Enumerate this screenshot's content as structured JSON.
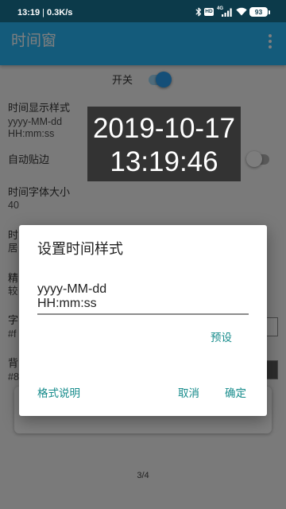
{
  "status_bar": {
    "time": "13:19",
    "separator": "|",
    "net_speed": "0.3K/s",
    "hd_label": "HD",
    "network_type": "4G",
    "battery_level": "93",
    "icons": [
      "bluetooth-icon",
      "hd-icon",
      "signal-icon",
      "wifi-icon",
      "battery-icon"
    ]
  },
  "app_bar": {
    "title": "时间窗",
    "menu_icon": "more-vert-icon"
  },
  "master_switch": {
    "label": "开关",
    "checked": true
  },
  "settings": {
    "time_format": {
      "label": "时间显示样式",
      "value_line1": "yyyy-MM-dd",
      "value_line2": "HH:mm:ss"
    },
    "auto_snap": {
      "label": "自动贴边",
      "checked": false
    },
    "font_size": {
      "label": "时间字体大小",
      "value": "40"
    },
    "partial_rows": [
      {
        "label": "时",
        "value": "居"
      },
      {
        "label": "精",
        "value": "较"
      },
      {
        "label": "字",
        "value": "#f",
        "swatch_color": "#ffffff"
      },
      {
        "label": "背",
        "value": "#8",
        "swatch_color": "#5a5a5a"
      }
    ]
  },
  "floating_clock": {
    "date": "2019-10-17",
    "time": "13:19:46"
  },
  "dialog": {
    "title": "设置时间样式",
    "input_value": "yyyy-MM-dd\nHH:mm:ss",
    "preset_button": "预设",
    "help_button": "格式说明",
    "cancel_button": "取消",
    "ok_button": "确定"
  },
  "page_indicator": "3/4",
  "colors": {
    "status_bar_bg": "#0c3a4a",
    "app_bar_bg": "#29b6f6",
    "page_bg": "#f4f4f4",
    "text_primary": "#333333",
    "accent": "#158b8b",
    "switch_on": "#2a9ef0",
    "clock_bg": "#333333",
    "clock_text": "#ffffff",
    "scrim": "rgba(0,0,0,0.5)"
  }
}
